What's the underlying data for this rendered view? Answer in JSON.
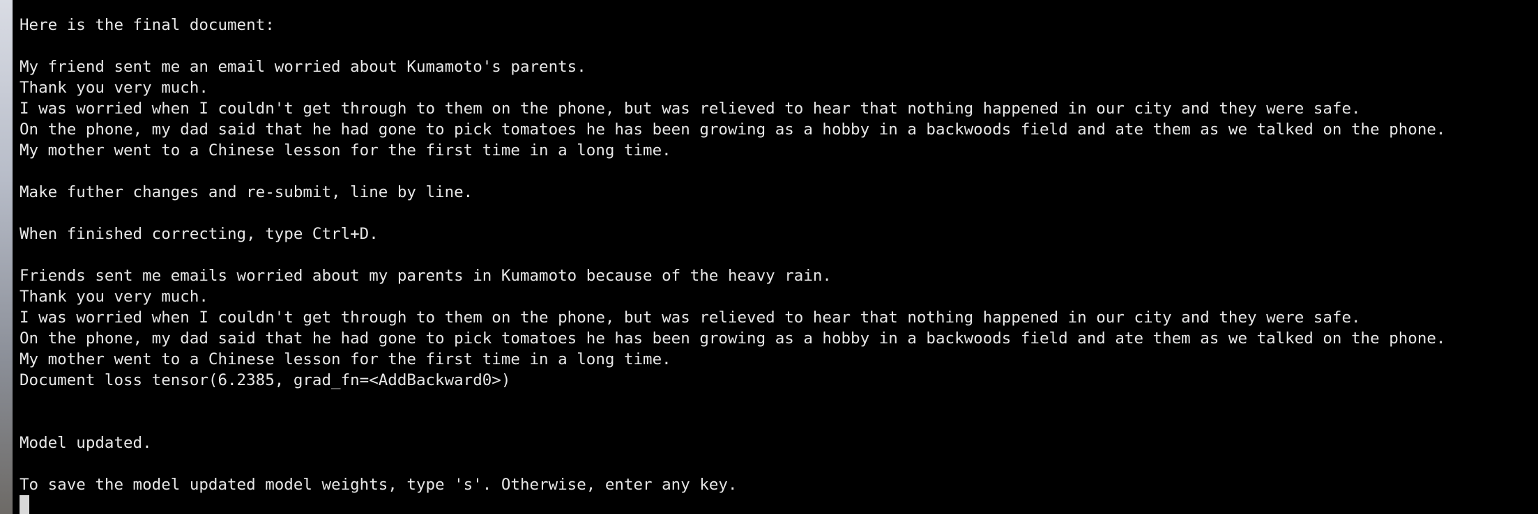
{
  "terminal": {
    "lines": [
      "Here is the final document:",
      "",
      "My friend sent me an email worried about Kumamoto's parents.",
      "Thank you very much.",
      "I was worried when I couldn't get through to them on the phone, but was relieved to hear that nothing happened in our city and they were safe.",
      "On the phone, my dad said that he had gone to pick tomatoes he has been growing as a hobby in a backwoods field and ate them as we talked on the phone.",
      "My mother went to a Chinese lesson for the first time in a long time.",
      "",
      "Make futher changes and re-submit, line by line.",
      "",
      "When finished correcting, type Ctrl+D.",
      "",
      "Friends sent me emails worried about my parents in Kumamoto because of the heavy rain.",
      "Thank you very much.",
      "I was worried when I couldn't get through to them on the phone, but was relieved to hear that nothing happened in our city and they were safe.",
      "On the phone, my dad said that he had gone to pick tomatoes he has been growing as a hobby in a backwoods field and ate them as we talked on the phone.",
      "My mother went to a Chinese lesson for the first time in a long time.",
      "Document loss tensor(6.2385, grad_fn=<AddBackward0>)",
      "",
      "",
      "Model updated.",
      "",
      "To save the model updated model weights, type 's'. Otherwise, enter any key."
    ]
  }
}
